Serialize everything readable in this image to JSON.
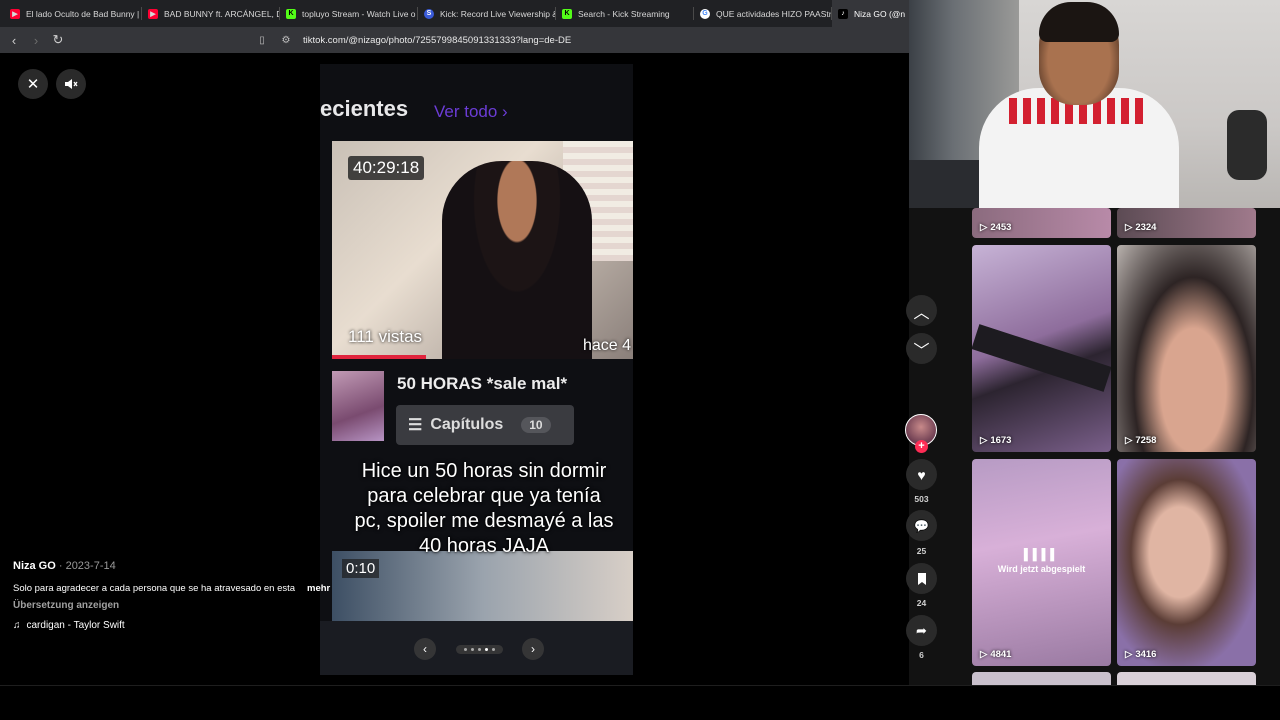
{
  "tabs": [
    {
      "label": "El lado Oculto de Bad Bunny |",
      "icon": "youtube-icon"
    },
    {
      "label": "BAD BUNNY ft. ARCÁNGEL, D",
      "icon": "youtube-icon"
    },
    {
      "label": "topluyo Stream - Watch Live o",
      "icon": "kick-icon"
    },
    {
      "label": "Kick: Record Live Viewership &",
      "icon": "streamscharts-icon"
    },
    {
      "label": "Search - Kick Streaming",
      "icon": "kick-icon"
    },
    {
      "label": "QUE actividades HIZO PAAStre",
      "icon": "google-icon"
    },
    {
      "label": "Niza GO (@n",
      "icon": "tiktok-icon",
      "active": true
    }
  ],
  "address": {
    "url": "tiktok.com/@nizago/photo/7255799845091331333?lang=de-DE"
  },
  "photo": {
    "header_title": "ecientes",
    "header_link": "Ver todo  ›",
    "video1_duration": "40:29:18",
    "video1_views": "111 vistas",
    "video1_ago": "hace 4",
    "video2_title": "50 HORAS *sale mal*",
    "chapters_label": "Capítulos",
    "chapters_count": "10",
    "overlay_caption": "Hice un 50 horas sin dormir para celebrar que ya tenía pc, spoiler me desmayé a las 40 horas JAJA",
    "video3_duration": "0:10",
    "slide_total": 5,
    "slide_current": 4
  },
  "post": {
    "author": "Niza GO",
    "date": " · 2023-7-14",
    "description": "Solo para agradecer a cada persona que se ha atravesado en esta",
    "more_label": "mehr",
    "translate_label": "Übersetzung anzeigen",
    "music": "cardigan - Taylor Swift"
  },
  "actions": {
    "likes": "503",
    "comments": "25",
    "saves": "24",
    "shares": "6"
  },
  "grid": {
    "now_playing_label": "Wird jetzt abgespielt",
    "tiles": [
      {
        "count": "2453"
      },
      {
        "count": "2324"
      },
      {
        "count": "1673"
      },
      {
        "count": "7258"
      },
      {
        "count": "4841"
      },
      {
        "count": "3416"
      }
    ]
  },
  "colors": {
    "accent": "#fe2c55",
    "link": "#6b3cd6",
    "progress": "#e0243d"
  }
}
